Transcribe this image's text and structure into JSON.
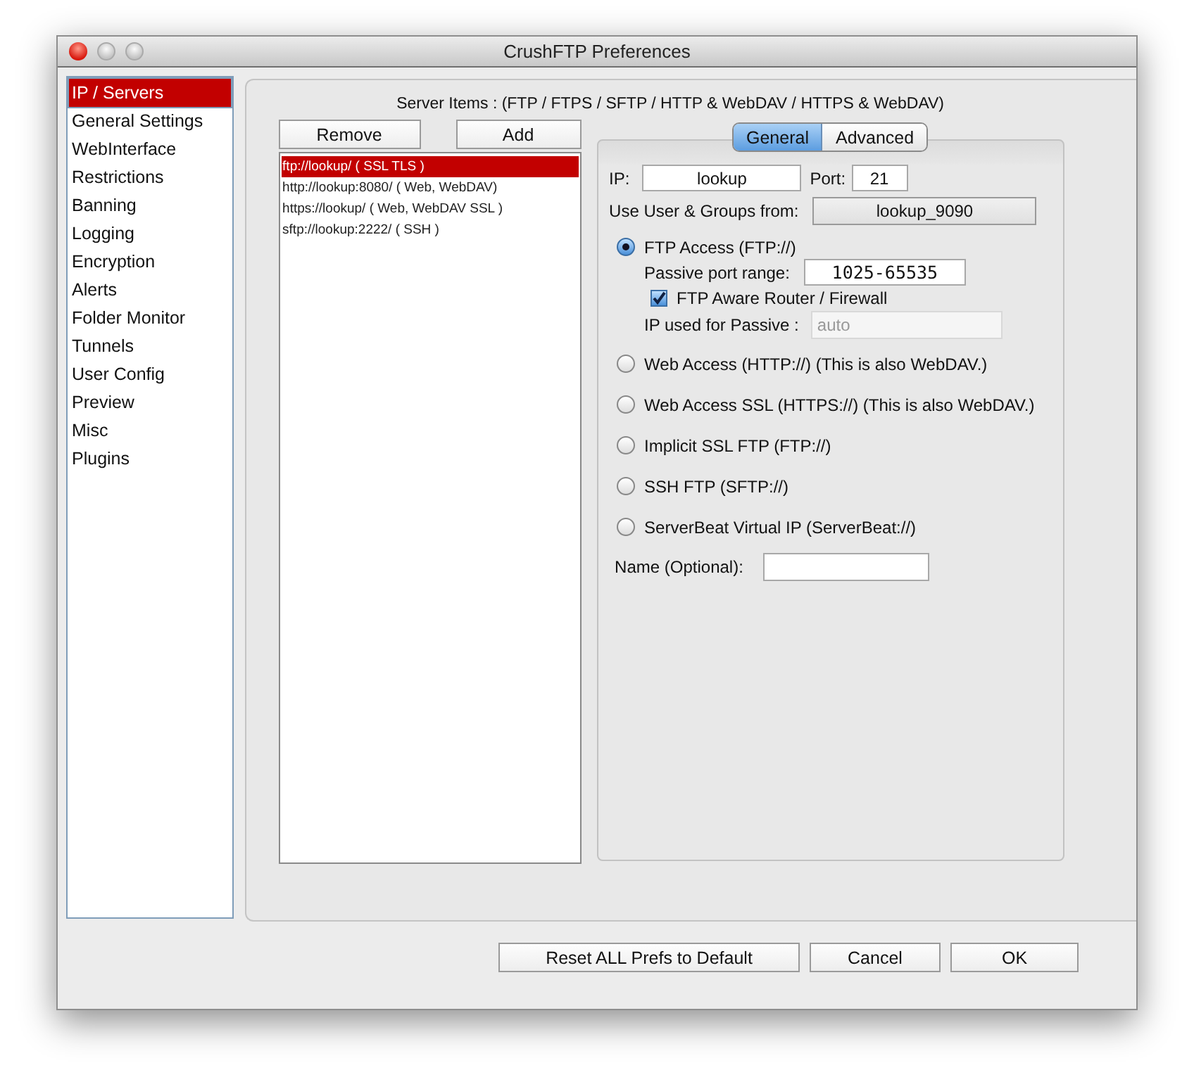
{
  "window": {
    "title": "CrushFTP Preferences"
  },
  "sidebar": {
    "items": [
      {
        "label": "IP / Servers",
        "selected": true
      },
      {
        "label": "General Settings",
        "selected": false
      },
      {
        "label": "WebInterface",
        "selected": false
      },
      {
        "label": "Restrictions",
        "selected": false
      },
      {
        "label": "Banning",
        "selected": false
      },
      {
        "label": "Logging",
        "selected": false
      },
      {
        "label": "Encryption",
        "selected": false
      },
      {
        "label": "Alerts",
        "selected": false
      },
      {
        "label": "Folder Monitor",
        "selected": false
      },
      {
        "label": "Tunnels",
        "selected": false
      },
      {
        "label": "User Config",
        "selected": false
      },
      {
        "label": "Preview",
        "selected": false
      },
      {
        "label": "Misc",
        "selected": false
      },
      {
        "label": "Plugins",
        "selected": false
      }
    ]
  },
  "server_items": {
    "heading": "Server Items : (FTP / FTPS / SFTP / HTTP & WebDAV / HTTPS & WebDAV)",
    "buttons": [
      "Remove",
      "Add"
    ],
    "list": [
      {
        "label": "ftp://lookup/ ( SSL TLS )",
        "selected": true
      },
      {
        "label": "http://lookup:8080/ ( Web, WebDAV)",
        "selected": false
      },
      {
        "label": "https://lookup/ ( Web, WebDAV SSL )",
        "selected": false
      },
      {
        "label": "sftp://lookup:2222/ ( SSH )",
        "selected": false
      }
    ]
  },
  "tabs": [
    {
      "label": "General",
      "selected": true
    },
    {
      "label": "Advanced",
      "selected": false
    }
  ],
  "general": {
    "ip_label": "IP:",
    "ip": "lookup",
    "port_label": "Port:",
    "port": "21",
    "users_label": "Use User & Groups from:",
    "users_button": "lookup_9090",
    "protocols": [
      {
        "label": "FTP Access (FTP://)",
        "selected": true
      },
      {
        "label": "Web Access (HTTP://) (This is also WebDAV.)",
        "selected": false
      },
      {
        "label": "Web Access SSL (HTTPS://) (This is also WebDAV.)",
        "selected": false
      },
      {
        "label": "Implicit SSL FTP (FTP://)",
        "selected": false
      },
      {
        "label": "SSH FTP (SFTP://)",
        "selected": false
      },
      {
        "label": "ServerBeat Virtual IP (ServerBeat://)",
        "selected": false
      }
    ],
    "passive_range_label": "Passive port range:",
    "passive_range": "1025-65535",
    "ftp_aware": {
      "label": "FTP Aware Router / Firewall",
      "checked": true
    },
    "passive_ip_label": "IP used for Passive :",
    "passive_ip": {
      "value": "auto",
      "disabled": true
    },
    "name_label": "Name (Optional):"
  },
  "footer_buttons": [
    "Reset ALL Prefs to Default",
    "Cancel",
    "OK"
  ]
}
